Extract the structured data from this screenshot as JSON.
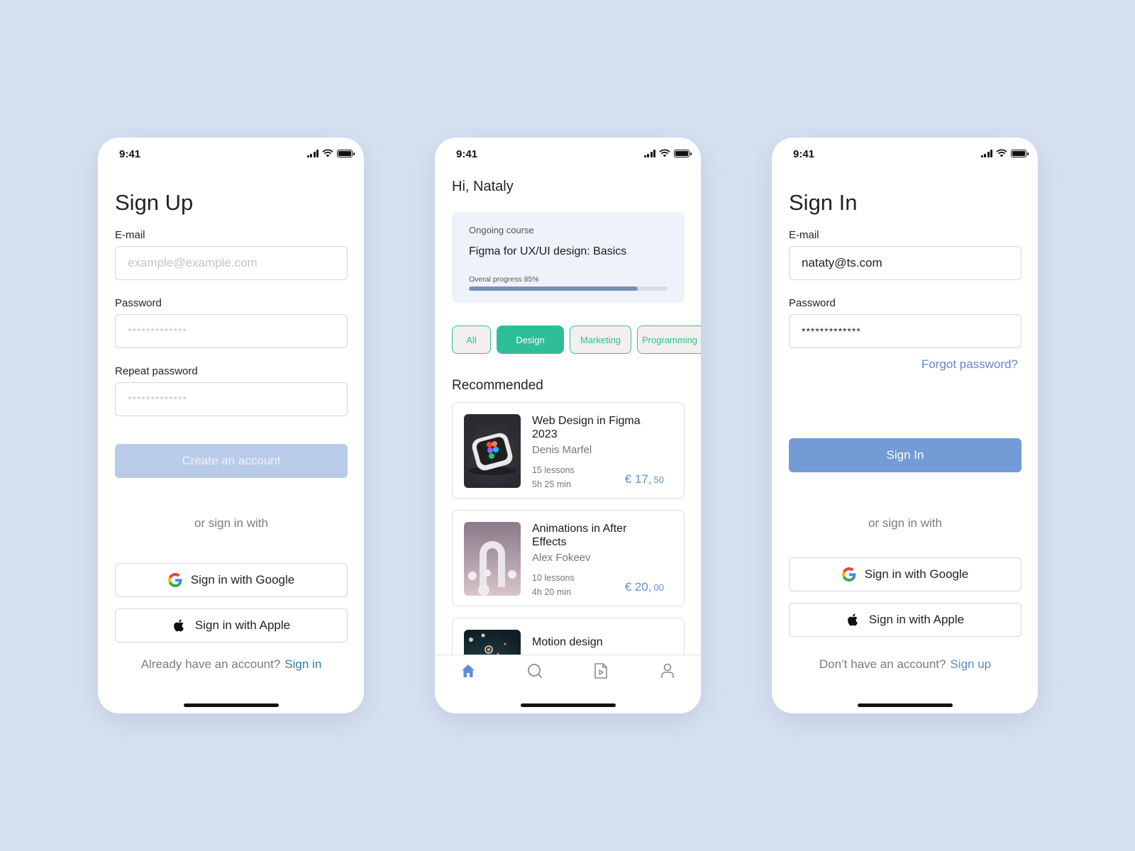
{
  "status_bar": {
    "time": "9:41"
  },
  "signup": {
    "title": "Sign Up",
    "email_label": "E-mail",
    "email_placeholder": "example@example.com",
    "password_label": "Password",
    "password_placeholder": "*************",
    "repeat_password_label": "Repeat password",
    "repeat_password_placeholder": "*************",
    "create_button": "Create an account",
    "or_text": "or sign in with",
    "google_button": "Sign in with Google",
    "apple_button": "Sign in with Apple",
    "footer_text": "Already have an account?",
    "footer_link": "Sign in"
  },
  "home": {
    "greeting": "Hi, Nataly",
    "ongoing": {
      "label": "Ongoing course",
      "title": "Figma for UX/UI design: Basics",
      "progress_label": "Overal progress 85%",
      "progress_percent": 85
    },
    "chips": [
      {
        "label": "All",
        "active": false
      },
      {
        "label": "Design",
        "active": true
      },
      {
        "label": "Marketing",
        "active": false
      },
      {
        "label": "Programming",
        "active": false
      }
    ],
    "section_title": "Recommended",
    "courses": [
      {
        "title": "Web Design in Figma 2023",
        "author": "Denis Marfel",
        "lessons": "15 lessons",
        "duration": "5h 25 min",
        "price_main": "€ 17,",
        "price_cents": "50"
      },
      {
        "title": "Animations in After Effects",
        "author": "Alex Fokeev",
        "lessons": "10 lessons",
        "duration": "4h 20 min",
        "price_main": "€ 20,",
        "price_cents": "00"
      },
      {
        "title": "Motion design"
      }
    ],
    "tabs": [
      {
        "icon": "home-icon",
        "active": true
      },
      {
        "icon": "search-icon",
        "active": false
      },
      {
        "icon": "video-file-icon",
        "active": false
      },
      {
        "icon": "profile-icon",
        "active": false
      }
    ],
    "colors": {
      "accent_green": "#2fbf98",
      "accent_blue": "#5e8fd6"
    }
  },
  "signin": {
    "title": "Sign In",
    "email_label": "E-mail",
    "email_value": "nataty@ts.com",
    "password_label": "Password",
    "password_value": "*************",
    "forgot_link": "Forgot password?",
    "signin_button": "Sign In",
    "or_text": "or sign in with",
    "google_button": "Sign in with Google",
    "apple_button": "Sign in with Apple",
    "footer_text": "Don’t have an account?",
    "footer_link": "Sign up"
  }
}
